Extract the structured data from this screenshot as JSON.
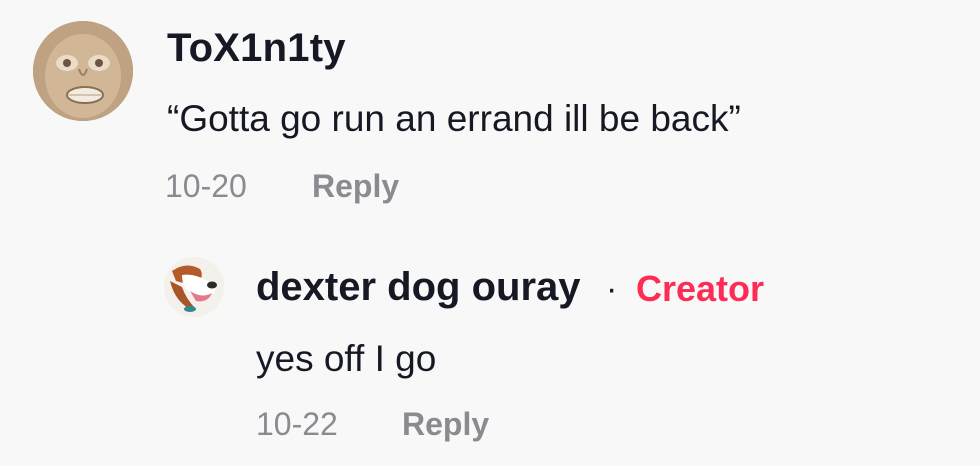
{
  "comments": [
    {
      "username": "ToX1n1ty",
      "text": "“Gotta go run an errand ill be back”",
      "date": "10-20",
      "reply_label": "Reply",
      "avatar_icon": "face-avatar"
    }
  ],
  "reply": {
    "username": "dexter dog ouray",
    "separator": "·",
    "badge": "Creator",
    "text": "yes off I go",
    "date": "10-22",
    "reply_label": "Reply",
    "avatar_icon": "dog-avatar"
  },
  "colors": {
    "background": "#f8f8f8",
    "primary_text": "#161823",
    "secondary_text": "#8a8b91",
    "creator_badge": "#fe2c55"
  }
}
